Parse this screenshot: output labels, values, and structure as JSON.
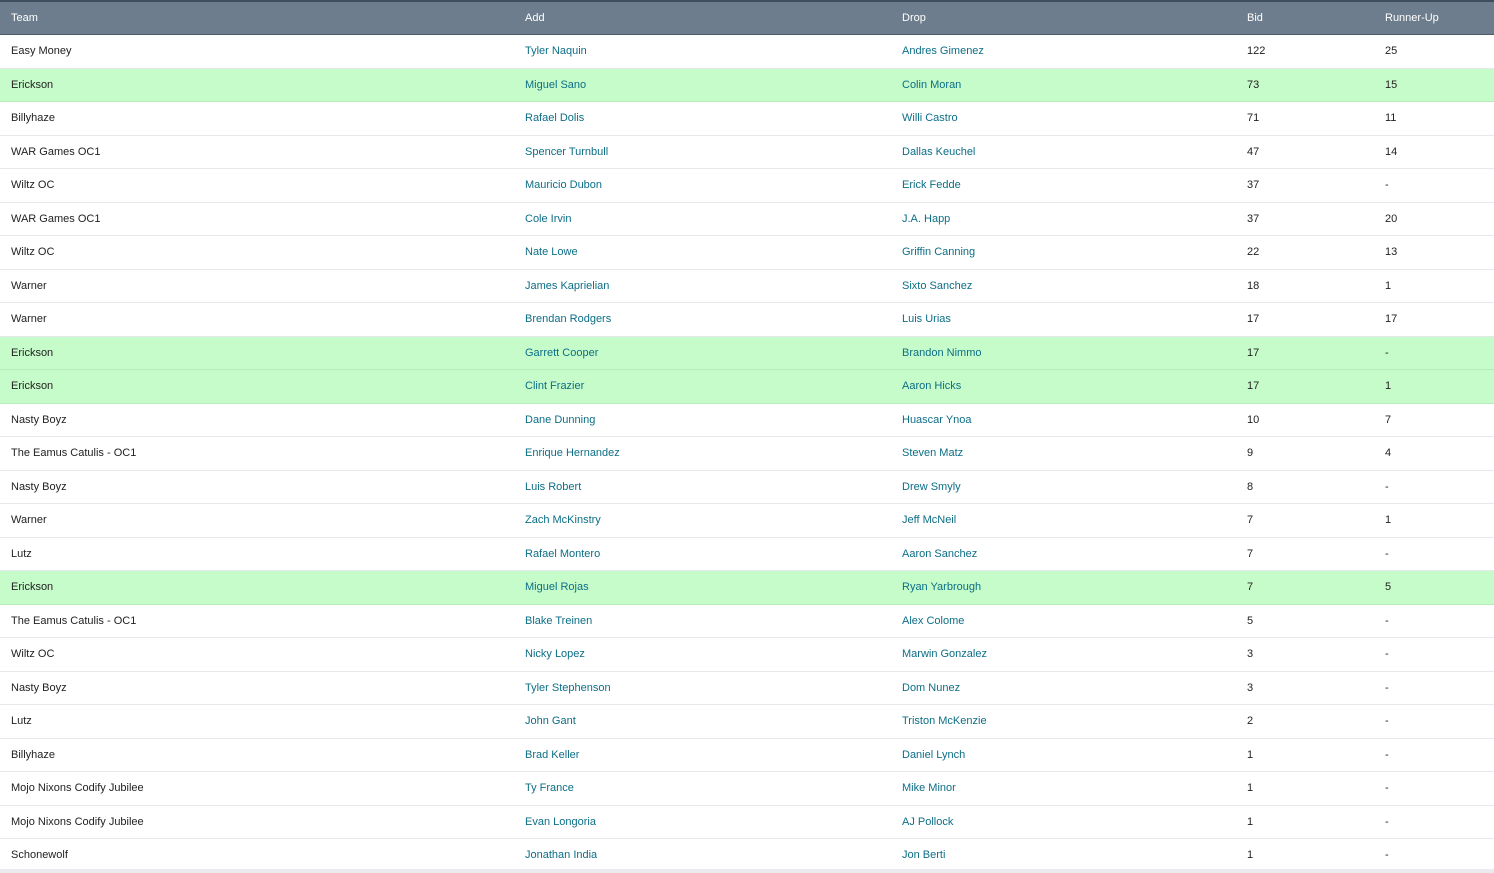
{
  "table": {
    "headers": {
      "team": "Team",
      "add": "Add",
      "drop": "Drop",
      "bid": "Bid",
      "runner_up": "Runner-Up"
    },
    "rows": [
      {
        "team": "Easy Money",
        "add": "Tyler Naquin",
        "drop": "Andres Gimenez",
        "bid": "122",
        "runner_up": "25",
        "highlight": false
      },
      {
        "team": "Erickson",
        "add": "Miguel Sano",
        "drop": "Colin Moran",
        "bid": "73",
        "runner_up": "15",
        "highlight": true
      },
      {
        "team": "Billyhaze",
        "add": "Rafael Dolis",
        "drop": "Willi Castro",
        "bid": "71",
        "runner_up": "11",
        "highlight": false
      },
      {
        "team": "WAR Games OC1",
        "add": "Spencer Turnbull",
        "drop": "Dallas Keuchel",
        "bid": "47",
        "runner_up": "14",
        "highlight": false
      },
      {
        "team": "Wiltz OC",
        "add": "Mauricio Dubon",
        "drop": "Erick Fedde",
        "bid": "37",
        "runner_up": "-",
        "highlight": false
      },
      {
        "team": "WAR Games OC1",
        "add": "Cole Irvin",
        "drop": "J.A. Happ",
        "bid": "37",
        "runner_up": "20",
        "highlight": false
      },
      {
        "team": "Wiltz OC",
        "add": "Nate Lowe",
        "drop": "Griffin Canning",
        "bid": "22",
        "runner_up": "13",
        "highlight": false
      },
      {
        "team": "Warner",
        "add": "James Kaprielian",
        "drop": "Sixto Sanchez",
        "bid": "18",
        "runner_up": "1",
        "highlight": false
      },
      {
        "team": "Warner",
        "add": "Brendan Rodgers",
        "drop": "Luis Urias",
        "bid": "17",
        "runner_up": "17",
        "highlight": false
      },
      {
        "team": "Erickson",
        "add": "Garrett Cooper",
        "drop": "Brandon Nimmo",
        "bid": "17",
        "runner_up": "-",
        "highlight": true
      },
      {
        "team": "Erickson",
        "add": "Clint Frazier",
        "drop": "Aaron Hicks",
        "bid": "17",
        "runner_up": "1",
        "highlight": true
      },
      {
        "team": "Nasty Boyz",
        "add": "Dane Dunning",
        "drop": "Huascar Ynoa",
        "bid": "10",
        "runner_up": "7",
        "highlight": false
      },
      {
        "team": "The Eamus Catulis - OC1",
        "add": "Enrique Hernandez",
        "drop": "Steven Matz",
        "bid": "9",
        "runner_up": "4",
        "highlight": false
      },
      {
        "team": "Nasty Boyz",
        "add": "Luis Robert",
        "drop": "Drew Smyly",
        "bid": "8",
        "runner_up": "-",
        "highlight": false
      },
      {
        "team": "Warner",
        "add": "Zach McKinstry",
        "drop": "Jeff McNeil",
        "bid": "7",
        "runner_up": "1",
        "highlight": false
      },
      {
        "team": "Lutz",
        "add": "Rafael Montero",
        "drop": "Aaron Sanchez",
        "bid": "7",
        "runner_up": "-",
        "highlight": false
      },
      {
        "team": "Erickson",
        "add": "Miguel Rojas",
        "drop": "Ryan Yarbrough",
        "bid": "7",
        "runner_up": "5",
        "highlight": true
      },
      {
        "team": "The Eamus Catulis - OC1",
        "add": "Blake Treinen",
        "drop": "Alex Colome",
        "bid": "5",
        "runner_up": "-",
        "highlight": false
      },
      {
        "team": "Wiltz OC",
        "add": "Nicky Lopez",
        "drop": "Marwin Gonzalez",
        "bid": "3",
        "runner_up": "-",
        "highlight": false
      },
      {
        "team": "Nasty Boyz",
        "add": "Tyler Stephenson",
        "drop": "Dom Nunez",
        "bid": "3",
        "runner_up": "-",
        "highlight": false
      },
      {
        "team": "Lutz",
        "add": "John Gant",
        "drop": "Triston McKenzie",
        "bid": "2",
        "runner_up": "-",
        "highlight": false
      },
      {
        "team": "Billyhaze",
        "add": "Brad Keller",
        "drop": "Daniel Lynch",
        "bid": "1",
        "runner_up": "-",
        "highlight": false
      },
      {
        "team": "Mojo Nixons Codify Jubilee",
        "add": "Ty France",
        "drop": "Mike Minor",
        "bid": "1",
        "runner_up": "-",
        "highlight": false
      },
      {
        "team": "Mojo Nixons Codify Jubilee",
        "add": "Evan Longoria",
        "drop": "AJ Pollock",
        "bid": "1",
        "runner_up": "-",
        "highlight": false
      },
      {
        "team": "Schonewolf",
        "add": "Jonathan India",
        "drop": "Jon Berti",
        "bid": "1",
        "runner_up": "-",
        "highlight": false
      }
    ]
  },
  "colors": {
    "header_bg": "#6d7d8d",
    "highlight_row_bg": "#c6fcc9",
    "link": "#0c6e86"
  }
}
